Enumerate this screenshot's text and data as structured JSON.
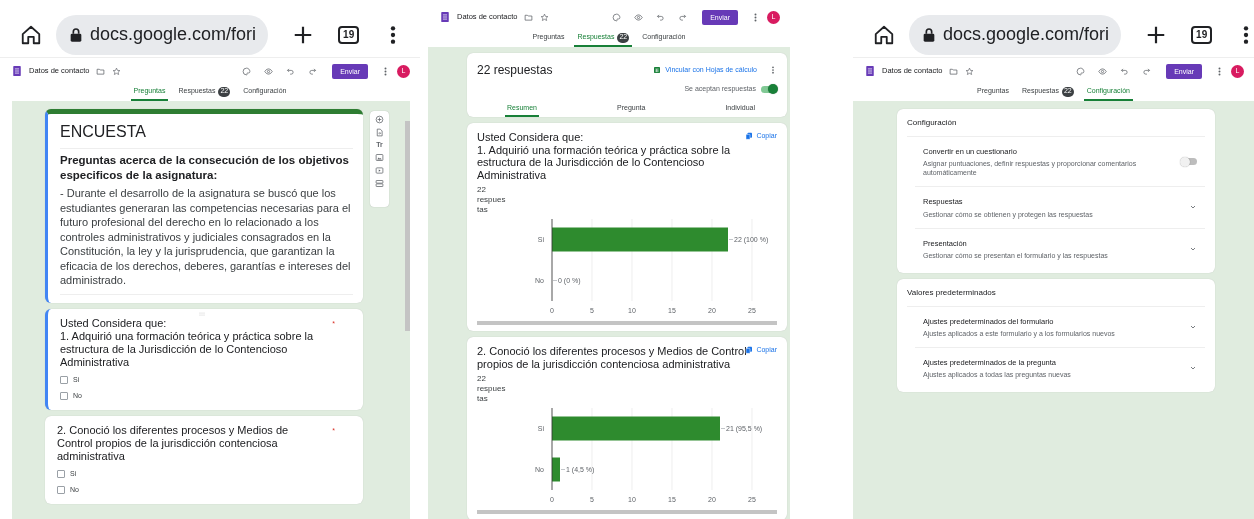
{
  "screens": [
    {
      "kind": "questions",
      "browser": {
        "url": "docs.google.com/fori",
        "tab_count": "19"
      },
      "header": {
        "title": "Datos de contacto",
        "send": "Enviar",
        "avatar": "L"
      },
      "tabs": [
        {
          "label": "Preguntas",
          "selected": true
        },
        {
          "label": "Respuestas",
          "badge": "22",
          "selected": false
        },
        {
          "label": "Configuración",
          "selected": false
        }
      ],
      "form": {
        "title": "ENCUESTA",
        "heading": "Preguntas acerca de la consecución de los objetivos especificos de la asignatura:",
        "description": "- Durante el desarrollo de la asignatura se buscó que los estudiantes generaran las competencias necesarias para el futuro profesional del derecho en lo relacionado a los controles administrativos y judiciales consagrados en la Constitución, la ley y la jurisprudencia, que garantizan la eficacia de los derechos, deberes, garantías e intereses del administrado.",
        "selected": true
      },
      "text_tool": "Tr",
      "questions": [
        {
          "text": "Usted Considera que:\n1. Adquirió una formación teórica y práctica sobre la estructura de la Jurisdicción de lo Contencioso Administrativa",
          "required_mark": "*",
          "selected": true,
          "options": [
            {
              "label": "Si",
              "checked": false
            },
            {
              "label": "No",
              "checked": false
            }
          ]
        },
        {
          "text": "2. Conoció los diferentes procesos y Medios de Control propios de la jurisdicción contenciosa administrativa",
          "required_mark": "*",
          "selected": false,
          "options": [
            {
              "label": "Si",
              "checked": false
            },
            {
              "label": "No",
              "checked": false
            }
          ]
        }
      ]
    },
    {
      "kind": "responses",
      "header": {
        "title": "Datos de contacto",
        "send": "Enviar",
        "avatar": "L"
      },
      "tabs": [
        {
          "label": "Preguntas",
          "selected": false
        },
        {
          "label": "Respuestas",
          "badge": "22",
          "selected": true
        },
        {
          "label": "Configuración",
          "selected": false
        }
      ],
      "summary": {
        "count": "22 respuestas",
        "link": "Vincular con Hojas de cálculo",
        "accepting_label": "Se aceptan respuestas",
        "accepting": true
      },
      "views": [
        {
          "label": "Resumen",
          "selected": true
        },
        {
          "label": "Pregunta",
          "selected": false
        },
        {
          "label": "Individual",
          "selected": false
        }
      ],
      "results": [
        {
          "question": "Usted Considera que:\n1. Adquirió una formación teórica y práctica sobre la estructura de la Jurisdicción de lo Contencioso Administrativa",
          "copy": "Copiar",
          "count": "22 respuestas",
          "chart_data": {
            "type": "bar",
            "orientation": "horizontal",
            "categories": [
              "Si",
              "No"
            ],
            "values": [
              22,
              0
            ],
            "grid": true,
            "xlim": [
              0,
              25
            ],
            "xticks": [
              0,
              5,
              10,
              15,
              20,
              25
            ],
            "value_labels": [
              "22 (100 %)",
              "0 (0 %)"
            ]
          }
        },
        {
          "question": "2. Conoció los diferentes procesos y Medios de Control propios de la jurisdicción contenciosa administrativa",
          "copy": "Copiar",
          "count": "22 respuestas",
          "chart_data": {
            "type": "bar",
            "orientation": "horizontal",
            "categories": [
              "Si",
              "No"
            ],
            "values": [
              21,
              1
            ],
            "grid": true,
            "xlim": [
              0,
              25
            ],
            "xticks": [
              0,
              5,
              10,
              15,
              20,
              25
            ],
            "value_labels": [
              "21 (95,5 %)",
              "1 (4,5 %)"
            ]
          }
        }
      ]
    },
    {
      "kind": "settings",
      "browser": {
        "url": "docs.google.com/fori",
        "tab_count": "19"
      },
      "header": {
        "title": "Datos de contacto",
        "send": "Enviar",
        "avatar": "L"
      },
      "tabs": [
        {
          "label": "Preguntas",
          "selected": false
        },
        {
          "label": "Respuestas",
          "badge": "22",
          "selected": false
        },
        {
          "label": "Configuración",
          "selected": true
        }
      ],
      "sections": [
        {
          "title": "Configuración",
          "items": [
            {
              "kind": "toggle",
              "title": "Convertir en un cuestionario",
              "description": "Asignar puntuaciones, definir respuestas y proporcionar comentarios automáticamente",
              "on": false
            },
            {
              "kind": "expand",
              "title": "Respuestas",
              "description": "Gestionar cómo se obtienen y protegen las respuestas"
            },
            {
              "kind": "expand",
              "title": "Presentación",
              "description": "Gestionar cómo se presentan el formulario y las respuestas"
            }
          ]
        },
        {
          "title": "Valores predeterminados",
          "items": [
            {
              "kind": "expand",
              "title": "Ajustes predeterminados del formulario",
              "description": "Ajustes aplicados a este formulario y a los formularios nuevos"
            },
            {
              "kind": "expand",
              "title": "Ajustes predeterminados de la pregunta",
              "description": "Ajustes aplicados a todas las preguntas nuevas"
            }
          ]
        }
      ]
    }
  ]
}
